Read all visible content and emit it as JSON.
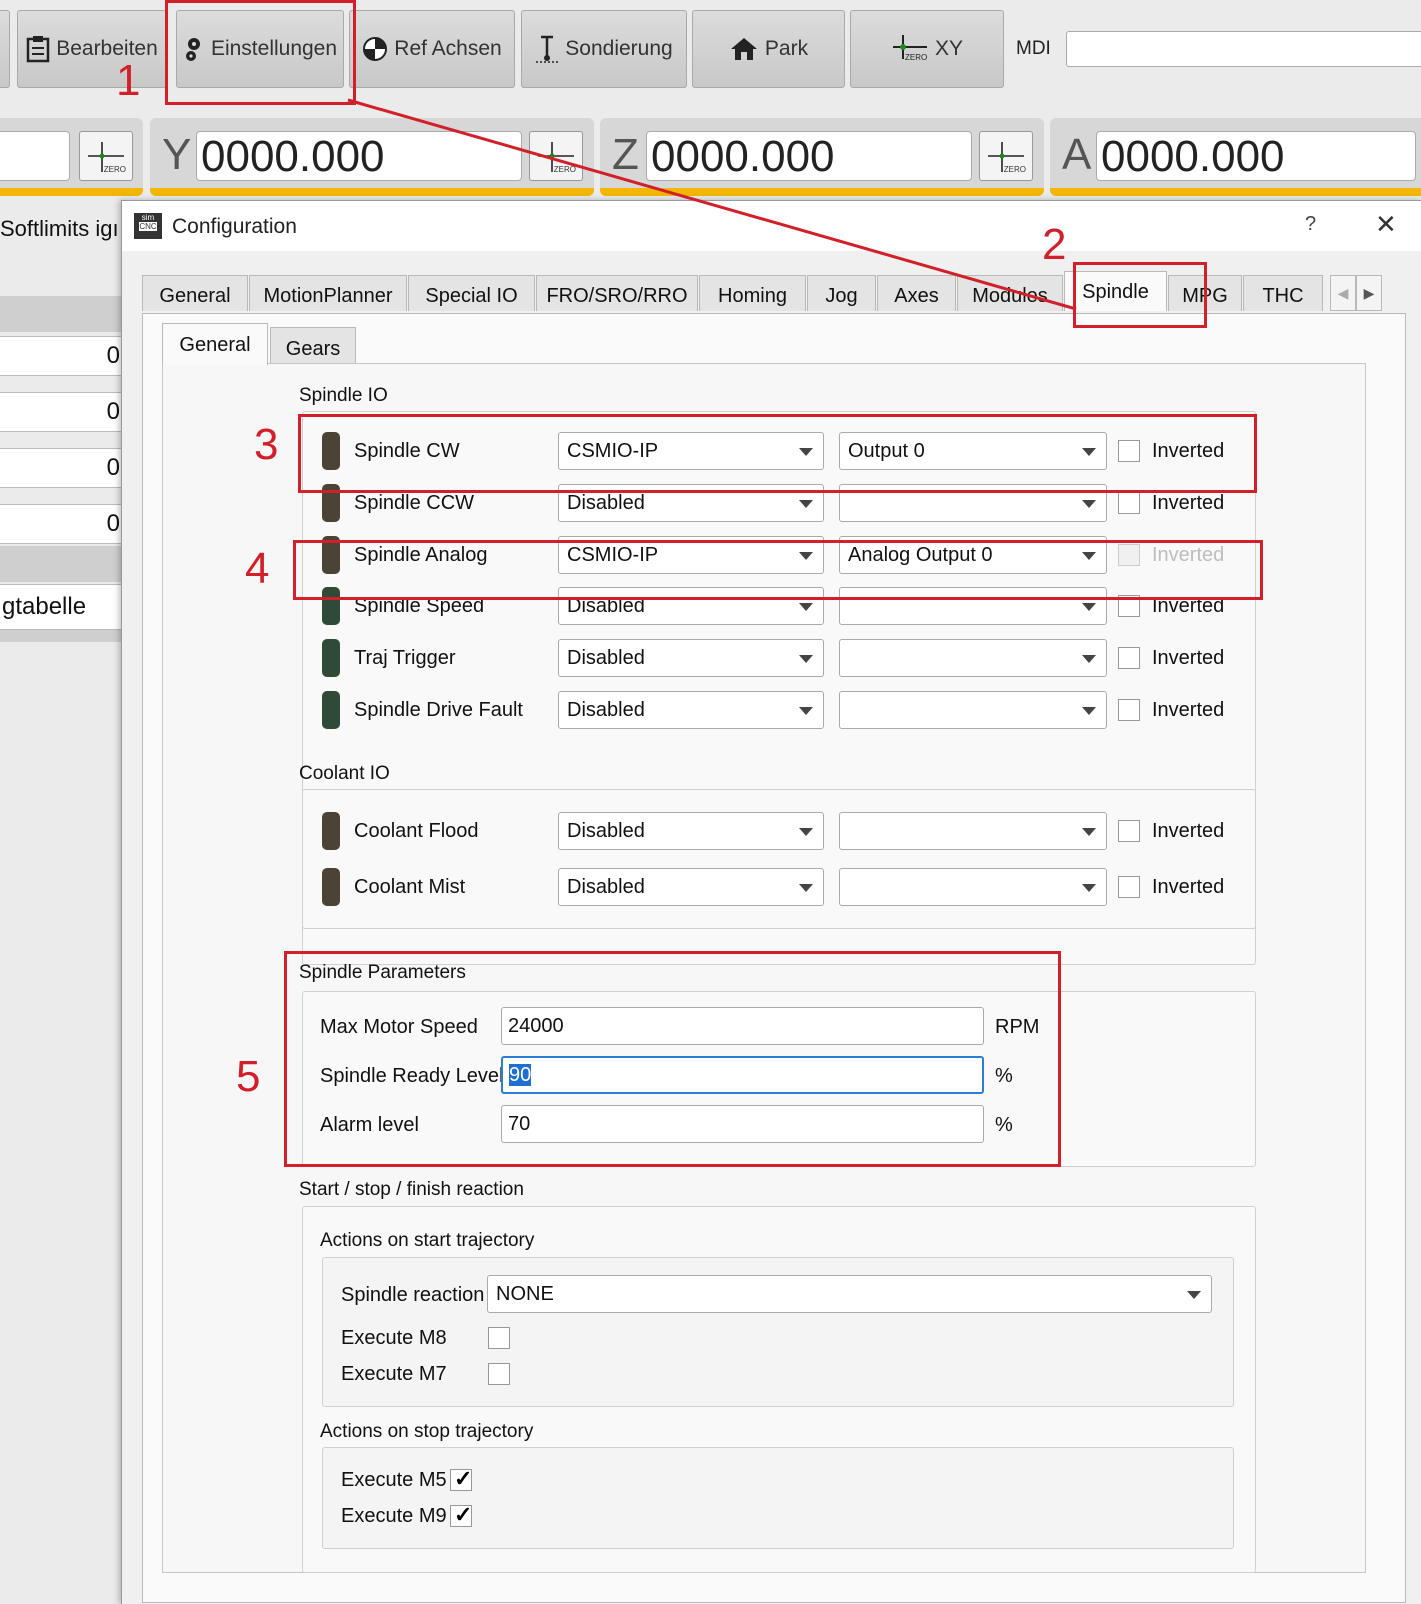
{
  "toolbar": {
    "buttons": [
      {
        "label": "Bearbeiten",
        "icon": "clipboard-icon"
      },
      {
        "label": "Einstellungen",
        "icon": "gear-icon"
      },
      {
        "label": "Ref Achsen",
        "icon": "reference-target-icon"
      },
      {
        "label": "Sondierung",
        "icon": "probe-icon"
      },
      {
        "label": "Park",
        "icon": "home-icon"
      },
      {
        "label": "XY",
        "icon": "zero-crosshair-icon",
        "icon_text": "ZERO"
      }
    ],
    "mdi_label": "MDI",
    "mdi_value": ""
  },
  "dro": {
    "axes": [
      {
        "axis": "",
        "value": ""
      },
      {
        "axis": "Y",
        "value": "0000.000"
      },
      {
        "axis": "Z",
        "value": "0000.000"
      },
      {
        "axis": "A",
        "value": "0000.000"
      }
    ],
    "zero_text": "ZERO",
    "accent_color": "#f2b705"
  },
  "background_panel": {
    "softlimits": "Softlimits igı",
    "values": [
      "0",
      "0",
      "0",
      "0"
    ],
    "table_label": "gtabelle"
  },
  "dialog": {
    "icon_text": [
      "sim",
      "CNC"
    ],
    "title": "Configuration",
    "help": "?",
    "close": "✕",
    "tabs": [
      "General",
      "MotionPlanner",
      "Special IO",
      "FRO/SRO/RRO",
      "Homing",
      "Jog",
      "Axes",
      "Modules",
      "Spindle",
      "MPG",
      "THC"
    ],
    "active_tab": "Spindle",
    "subtabs": [
      "General",
      "Gears"
    ],
    "active_subtab": "General",
    "spindle_io": {
      "title": "Spindle IO",
      "rows": [
        {
          "label": "Spindle CW",
          "device": "CSMIO-IP",
          "port": "Output 0",
          "inverted_label": "Inverted",
          "inverted": false,
          "enabled": true
        },
        {
          "label": "Spindle CCW",
          "device": "Disabled",
          "port": "",
          "inverted_label": "Inverted",
          "inverted": false,
          "enabled": true
        },
        {
          "label": "Spindle Analog",
          "device": "CSMIO-IP",
          "port": "Analog Output 0",
          "inverted_label": "Inverted",
          "inverted": false,
          "enabled": false
        },
        {
          "label": "Spindle Speed",
          "device": "Disabled",
          "port": "",
          "inverted_label": "Inverted",
          "inverted": false,
          "enabled": true
        },
        {
          "label": "Traj Trigger",
          "device": "Disabled",
          "port": "",
          "inverted_label": "Inverted",
          "inverted": false,
          "enabled": true
        },
        {
          "label": "Spindle Drive Fault",
          "device": "Disabled",
          "port": "",
          "inverted_label": "Inverted",
          "inverted": false,
          "enabled": true
        }
      ]
    },
    "coolant_io": {
      "title": "Coolant IO",
      "rows": [
        {
          "label": "Coolant Flood",
          "device": "Disabled",
          "port": "",
          "inverted_label": "Inverted",
          "inverted": false
        },
        {
          "label": "Coolant Mist",
          "device": "Disabled",
          "port": "",
          "inverted_label": "Inverted",
          "inverted": false
        }
      ]
    },
    "spindle_parameters": {
      "title": "Spindle Parameters",
      "fields": [
        {
          "label": "Max Motor Speed",
          "value": "24000",
          "unit": "RPM"
        },
        {
          "label": "Spindle Ready Level",
          "value": "90",
          "unit": "%"
        },
        {
          "label": "Alarm level",
          "value": "70",
          "unit": "%"
        }
      ]
    },
    "reactions": {
      "title": "Start / stop / finish reaction",
      "start": {
        "title": "Actions on start trajectory",
        "spindle_reaction_label": "Spindle reaction",
        "spindle_reaction_value": "NONE",
        "execute_m8_label": "Execute M8",
        "execute_m8": false,
        "execute_m7_label": "Execute M7",
        "execute_m7": false
      },
      "stop": {
        "title": "Actions on stop trajectory",
        "execute_m5_label": "Execute M5",
        "execute_m5": true,
        "execute_m9_label": "Execute M9",
        "execute_m9": true
      }
    }
  },
  "annotations": {
    "color": "#d1202a",
    "numbers": [
      "1",
      "2",
      "3",
      "4",
      "5"
    ]
  }
}
